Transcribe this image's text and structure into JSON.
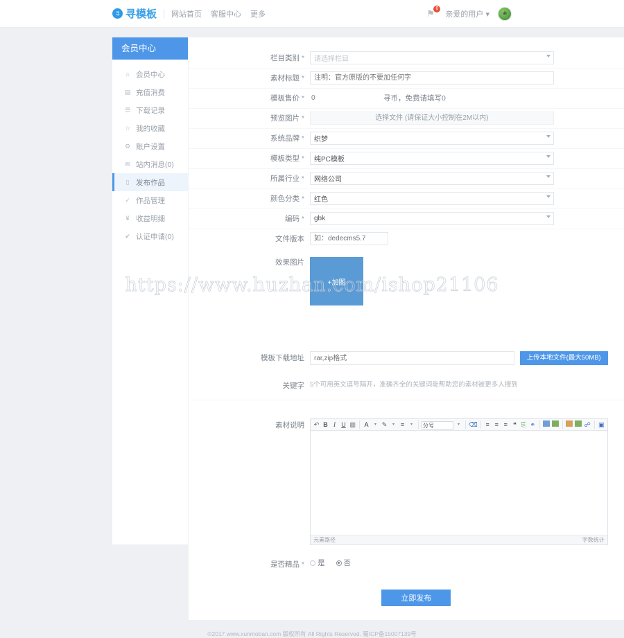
{
  "header": {
    "logo_mark": "寻",
    "logo_text": "寻模板",
    "nav": [
      {
        "label": "网站首页"
      },
      {
        "label": "客服中心"
      },
      {
        "label": "更多"
      }
    ],
    "bell_icon": "⚑",
    "notification_count": "0",
    "user_menu": "亲爱的用户",
    "avatar_icon": "❀"
  },
  "sidebar": {
    "title": "会员中心",
    "items": [
      {
        "label": "会员中心",
        "icon": "⌂",
        "icon_name": "home-icon",
        "active": false
      },
      {
        "label": "充值消费",
        "icon": "▤",
        "icon_name": "wallet-icon",
        "active": false
      },
      {
        "label": "下载记录",
        "icon": "☰",
        "icon_name": "download-icon",
        "active": false
      },
      {
        "label": "我的收藏",
        "icon": "☆",
        "icon_name": "star-icon",
        "active": false
      },
      {
        "label": "账户设置",
        "icon": "⚙",
        "icon_name": "gear-icon",
        "active": false
      },
      {
        "label": "站内消息(0)",
        "icon": "✉",
        "icon_name": "envelope-icon",
        "active": false
      },
      {
        "label": "发布作品",
        "icon": "▯",
        "icon_name": "document-icon",
        "active": true
      },
      {
        "label": "作品管理",
        "icon": "✓",
        "icon_name": "check-icon",
        "active": false
      },
      {
        "label": "收益明细",
        "icon": "¥",
        "icon_name": "yen-icon",
        "active": false
      },
      {
        "label": "认证申请(0)",
        "icon": "✔",
        "icon_name": "verify-icon",
        "active": false
      }
    ]
  },
  "form": {
    "category": {
      "label": "栏目类别",
      "required": true,
      "value": "请选择栏目",
      "is_placeholder": true
    },
    "title": {
      "label": "素材标题",
      "required": true,
      "value": "",
      "placeholder": "注明：官方原版的不要加任何字"
    },
    "price": {
      "label": "模板售价",
      "required": true,
      "value": "0",
      "hint": "寻币，免费请填写0"
    },
    "preview": {
      "label": "预览图片",
      "required": true,
      "button_label": "选择文件 (请保证大小控制在2M以内)"
    },
    "brand": {
      "label": "系统品牌",
      "required": true,
      "value": "织梦"
    },
    "template_type": {
      "label": "模板类型",
      "required": true,
      "value": "纯PC模板"
    },
    "industry": {
      "label": "所属行业",
      "required": true,
      "value": "网络公司"
    },
    "color": {
      "label": "颜色分类",
      "required": true,
      "value": "红色"
    },
    "encoding": {
      "label": "编码",
      "required": true,
      "value": "gbk"
    },
    "file_version": {
      "label": "文件版本",
      "required": false,
      "value": "",
      "placeholder": "如：dedecms5.7"
    },
    "effect_images": {
      "label": "效果图片",
      "add_button": "+加图"
    },
    "download_url": {
      "label": "模板下载地址",
      "required": false,
      "value": "",
      "placeholder": "rar,zip格式",
      "upload_button": "上传本地文件(最大50MB)"
    },
    "keywords": {
      "label": "关键字",
      "hint": "5个可用英文逗号隔开，准确齐全的关键词能帮助您的素材被更多人搜到"
    },
    "description": {
      "label": "素材说明"
    },
    "is_premium": {
      "label": "是否精品",
      "required": true,
      "options": [
        {
          "label": "是",
          "selected": false
        },
        {
          "label": "否",
          "selected": true
        }
      ]
    },
    "submit_label": "立即发布"
  },
  "editor": {
    "toolbar": [
      {
        "name": "undo-icon",
        "glyph": "↶",
        "kind": "glyph"
      },
      {
        "name": "bold-icon",
        "glyph": "B",
        "kind": "bold"
      },
      {
        "name": "italic-icon",
        "glyph": "I",
        "kind": "italic"
      },
      {
        "name": "underline-icon",
        "glyph": "U",
        "kind": "underline"
      },
      {
        "name": "strikethrough-icon",
        "glyph": "▥",
        "kind": "glyph"
      },
      {
        "name": "font-color-icon",
        "glyph": "A",
        "kind": "colorA"
      },
      {
        "name": "highlight-icon",
        "glyph": "✎",
        "kind": "glyph"
      },
      {
        "name": "list-icon",
        "glyph": "≡",
        "kind": "glyph"
      }
    ],
    "font_size_value": "分号",
    "toolbar2": [
      {
        "name": "remove-format-icon",
        "glyph": "⌫"
      },
      {
        "name": "align-left-icon",
        "glyph": "≡"
      },
      {
        "name": "align-center-icon",
        "glyph": "≡"
      },
      {
        "name": "align-right-icon",
        "glyph": "≡"
      },
      {
        "name": "quote-icon",
        "glyph": "❝"
      },
      {
        "name": "source-code-icon",
        "glyph": "⎘"
      },
      {
        "name": "link-icon",
        "glyph": "⚭"
      }
    ],
    "status_path": "元素路径",
    "status_count": "字数统计"
  },
  "watermark": "https://www.huzhan.com/ishop21106",
  "footer": "©2017 www.xunmoban.com 版权所有 All Rights Reserved. 蜀ICP备15007139号"
}
